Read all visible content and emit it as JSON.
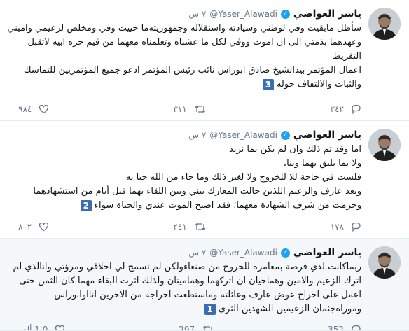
{
  "tweets": [
    {
      "name": "ياسر العواضي",
      "handle": "@Yaser_Alawadi",
      "time": "٧ س",
      "verified_mark": "✓",
      "text": "سأظل مابقيت وفي لوطني وسيادته واستقلاله وجمهوريته‌ما حييت وفي ومخلص لزعيمي واميني وعهدهما بذمتي الى ان اموت ووفي لكل ما عشناه وتعلمناه معهما من قيم حره ابيه لاتقبل التفريط\nاعمال المؤتمر بيدالشيخ صادق ابوراس نائب رئيس المؤتمر ادعو جميع المؤتمريين للتماسك والثبات والالتفاف حوله",
      "badge": "3",
      "replies": "٣٤٢",
      "retweets": "٣١١",
      "likes": "٩٨٤"
    },
    {
      "name": "ياسر العواضي",
      "handle": "@Yaser_Alawadi",
      "time": "٧ س",
      "verified_mark": "✓",
      "text": "اما وقد تم ذلك وان لم يكن بما نريد\nولا بما يليق بهما وبنا،\nفلست في حاجة للا للخروج ولا لغير ذلك وما جاء من الله حيا به\nوبعد عارف والزعيم اللذين حالت المعارك بيني وبين اللقاء بهما قبل أيام من استشهادهما وحرمت من شرف الشهادة معهما؛ فقد اصبح الموت عندي والحياة سواء",
      "badge": "2",
      "replies": "١٧٨",
      "retweets": "٢٤١",
      "likes": "٨٠٢"
    },
    {
      "name": "ياسر العواضي",
      "handle": "@Yaser_Alawadi",
      "time": "٧ س",
      "verified_mark": "✓",
      "text": "ربماكانت لدي فرصة بمغامرة للخروج من صنعاءولكن لم تسمح لي اخلاقي ومرؤتي وانالذي لم اترك الزعيم والامين وهماحيان ان اتركهما وهماميتان ولذلك اثرت البقاء مهما كان الثمن حتى اعمل على اخراج عوض عارف وعائلته وماستطعت اخراجه من الاخرين انااوابوراس وموراةجثمان الزعيمين الشهدين الثرى",
      "badge": "1",
      "replies": "352",
      "retweets": "297",
      "likes": "1.0 ألف"
    }
  ]
}
